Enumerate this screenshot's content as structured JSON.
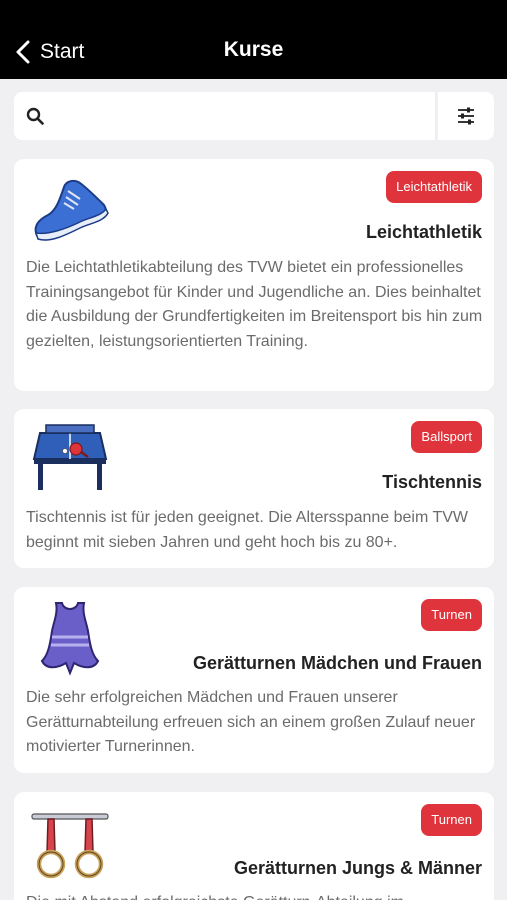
{
  "header": {
    "back_label": "Start",
    "title": "Kurse"
  },
  "search": {
    "value": "",
    "placeholder": ""
  },
  "icons": {
    "back": "chevron-left-icon",
    "search": "search-icon",
    "filter": "sliders-icon"
  },
  "colors": {
    "topbar": "#000000",
    "badge": "#e0343c",
    "background": "#f0f0f2",
    "card": "#ffffff"
  },
  "courses": [
    {
      "tag": "Leichtathletik",
      "title": "Leichtathletik",
      "description": "Die Leichtathletikabteilung des TVW bietet ein professionelles Trainingsangebot für Kinder und Jugendliche an. Dies beinhaltet die Ausbildung der Grundfertigkeiten im Breitensport bis hin zum gezielten, leistungsorientierten Training.",
      "icon": "running-shoe-icon"
    },
    {
      "tag": "Ballsport",
      "title": "Tischtennis",
      "description": "Tischtennis ist für jeden geeignet. Die Altersspanne beim TVW beginnt mit sieben Jahren und geht hoch bis zu 80+.",
      "icon": "table-tennis-icon"
    },
    {
      "tag": "Turnen",
      "title": "Gerätturnen Mädchen und Frauen",
      "description": "Die sehr erfolgreichen Mädchen und Frauen unserer Gerätturnabteilung erfreuen sich an einem großen Zulauf neuer motivierter Turnerinnen.",
      "icon": "leotard-icon"
    },
    {
      "tag": "Turnen",
      "title": "Gerätturnen Jungs & Männer",
      "description": "Die mit Abstand erfolgreichste Gerätturn-Abteilung im",
      "icon": "gymnastic-rings-icon"
    }
  ]
}
